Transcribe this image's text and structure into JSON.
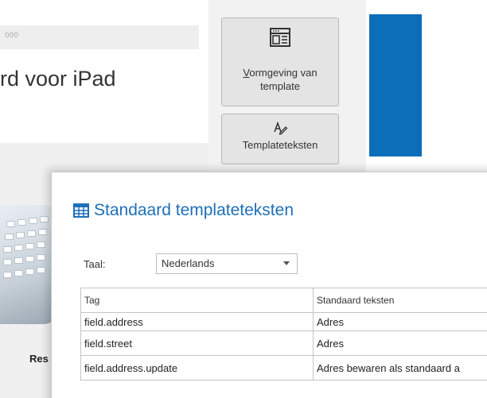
{
  "background_page": {
    "breadcrumb": "000",
    "product_title": "rd voor iPad",
    "product_caption": "Res"
  },
  "ribbon": {
    "layout_button": {
      "line1_underlined": "V",
      "line1_rest": "ormgeving van",
      "line2": "template",
      "icon": "layout-icon"
    },
    "texts_button": {
      "label": "Templateteksten",
      "icon": "pen-text-icon"
    }
  },
  "colors": {
    "accent_blue": "#0a6eb8",
    "dialog_title": "#1f6fb8"
  },
  "dialog": {
    "title": "Standaard templateteksten",
    "title_icon": "grid-icon",
    "language_label": "Taal:",
    "language_value": "Nederlands",
    "table": {
      "columns": [
        "Tag",
        "Standaard teksten"
      ],
      "rows": [
        {
          "tag": "field.address",
          "text": "Adres"
        },
        {
          "tag": "field.street",
          "text": "Adres"
        },
        {
          "tag": "field.address.update",
          "text": "Adres bewaren als standaard a"
        }
      ]
    }
  }
}
